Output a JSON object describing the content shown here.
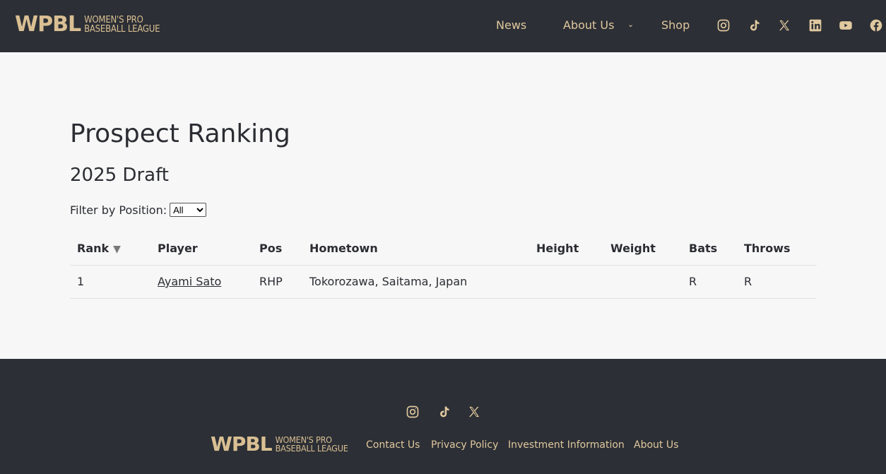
{
  "header": {
    "logo_mark": "WPBL",
    "logo_line1": "WOMEN'S PRO",
    "logo_line2": "BASEBALL LEAGUE",
    "nav": {
      "news": "News",
      "about": "About Us",
      "shop": "Shop"
    },
    "social_icons": [
      "instagram-icon",
      "tiktok-icon",
      "x-icon",
      "linkedin-icon",
      "youtube-icon",
      "facebook-icon"
    ]
  },
  "main": {
    "title": "Prospect Ranking",
    "subtitle": "2025 Draft",
    "filter_label": "Filter by Position:",
    "filter_selected": "All",
    "table": {
      "headers": [
        "Rank",
        "Player",
        "Pos",
        "Hometown",
        "Height",
        "Weight",
        "Bats",
        "Throws"
      ],
      "sort_indicator": "▼",
      "rows": [
        {
          "rank": "1",
          "player": "Ayami Sato",
          "pos": "RHP",
          "hometown": "Tokorozawa, Saitama, Japan",
          "height": "",
          "weight": "",
          "bats": "R",
          "throws": "R"
        }
      ]
    }
  },
  "footer": {
    "logo_mark": "WPBL",
    "logo_line1": "WOMEN'S PRO",
    "logo_line2": "BASEBALL LEAGUE",
    "links": {
      "contact": "Contact Us",
      "privacy": "Privacy Policy",
      "investment": "Investment Information",
      "about": "About Us"
    },
    "social_icons": [
      "instagram-icon",
      "tiktok-icon",
      "x-icon"
    ]
  },
  "colors": {
    "header_bg": "#2c2f35",
    "accent_gold": "#d9bf93",
    "page_bg": "#f7f7f7",
    "text": "#2b2d33"
  }
}
